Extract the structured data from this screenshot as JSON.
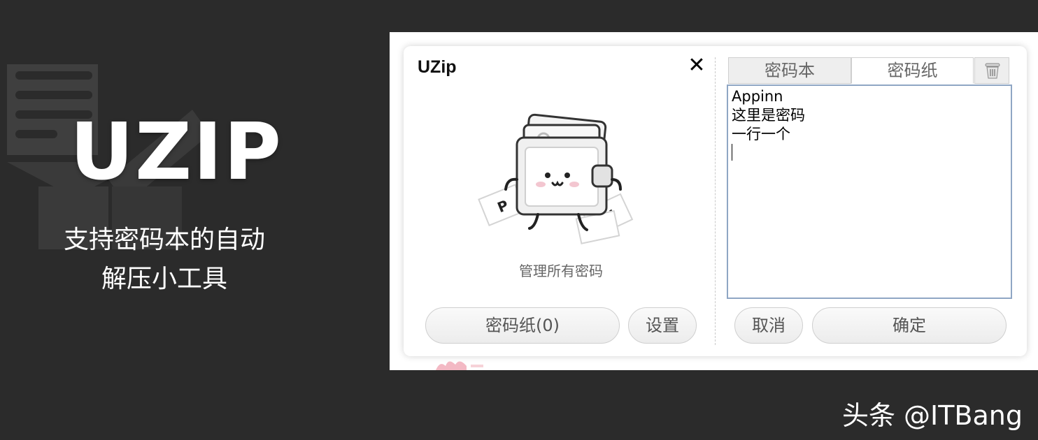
{
  "promo": {
    "title": "UZIP",
    "subtitle_line1": "支持密码本的自动",
    "subtitle_line2": "解压小工具"
  },
  "app": {
    "title": "UZip",
    "close_icon": "close-icon",
    "hint": "管理所有密码",
    "buttons": {
      "password_paper": "密码纸(0)",
      "settings": "设置",
      "cancel": "取消",
      "confirm": "确定"
    },
    "tabs": {
      "password_book": "密码本",
      "password_paper": "密码纸",
      "trash_icon": "trash-icon"
    },
    "password_lines": [
      "Appinn",
      "这里是密码",
      "一行一个"
    ]
  },
  "footer": {
    "credit": "头条 @ITBang"
  },
  "colors": {
    "background": "#2b2b2b",
    "textarea_border": "#8fa6c4",
    "watermark": "#f3b9c4"
  }
}
